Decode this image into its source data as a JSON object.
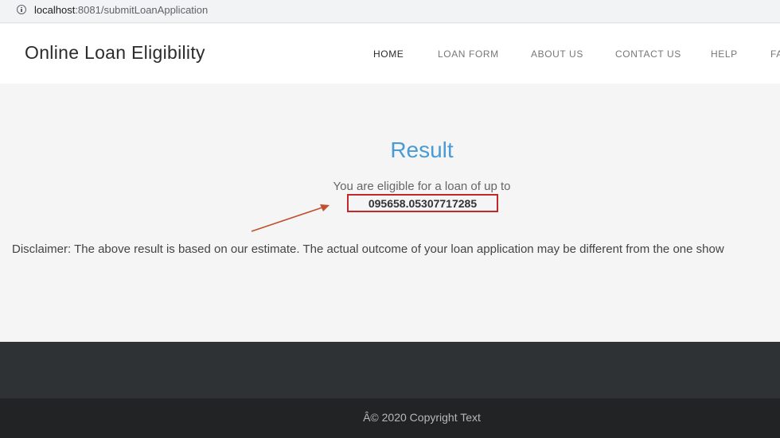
{
  "browser": {
    "url_host": "localhost",
    "url_rest": ":8081/submitLoanApplication",
    "info_icon": "info-icon"
  },
  "navbar": {
    "brand": "Online Loan Eligibility",
    "items": [
      {
        "label": "HOME",
        "active": true
      },
      {
        "label": "LOAN FORM",
        "active": false
      },
      {
        "label": "ABOUT US",
        "active": false
      },
      {
        "label": "CONTACT US",
        "active": false
      },
      {
        "label": "HELP",
        "active": false
      },
      {
        "label": "FA",
        "active": false
      }
    ]
  },
  "result": {
    "title": "Result",
    "eligible_text": "You are eligible for a loan of up to",
    "amount": "095658.05307717285",
    "disclaimer": "Disclaimer: The above result is based on our estimate. The actual outcome of your loan application may be different from the one show",
    "annotation_color": "#c0282a"
  },
  "footer": {
    "copyright": "Â© 2020 Copyright Text"
  },
  "colors": {
    "accent": "#4a9ad6",
    "footer_top": "#2f3234",
    "footer_bottom": "#212325"
  }
}
